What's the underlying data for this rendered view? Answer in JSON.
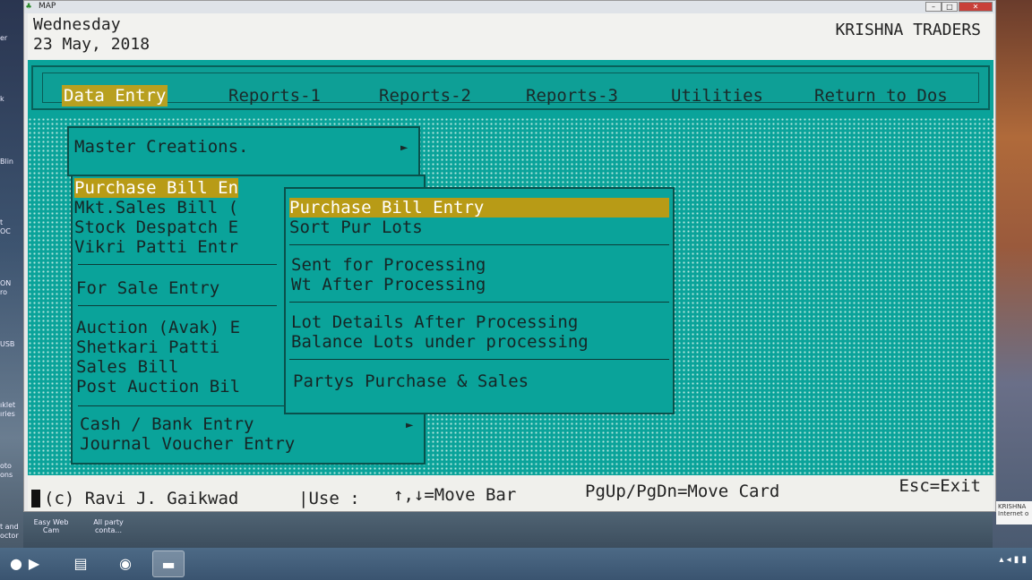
{
  "window": {
    "title": "MAP",
    "btn_min": "–",
    "btn_max": "□",
    "btn_close": "✕"
  },
  "header": {
    "day": "Wednesday",
    "date": "23 May, 2018",
    "company": "KRISHNA TRADERS"
  },
  "menubar": [
    {
      "label": "Data Entry",
      "active": true
    },
    {
      "label": "Reports-1"
    },
    {
      "label": "Reports-2"
    },
    {
      "label": "Reports-3"
    },
    {
      "label": "Utilities"
    },
    {
      "label": "Return to Dos"
    }
  ],
  "main_menu": {
    "master": "Master Creations.",
    "items_a": [
      "Purchase Bill En",
      "Mkt.Sales Bill (",
      "Stock Despatch E",
      "Vikri Patti Entr"
    ],
    "item_b": "For Sale Entry",
    "items_c": [
      "Auction (Avak) E",
      "Shetkari Patti",
      "Sales Bill",
      "Post Auction Bil"
    ],
    "items_d": [
      "Cash / Bank Entry",
      "Journal Voucher Entry"
    ],
    "arrow": "►"
  },
  "submenu": {
    "group1": [
      "Purchase Bill Entry",
      "Sort Pur Lots"
    ],
    "group2": [
      "Sent for Processing",
      "Wt After Processing"
    ],
    "group3": [
      "Lot Details After Processing",
      "Balance Lots under processing"
    ],
    "group4": [
      "Partys Purchase & Sales"
    ]
  },
  "status": {
    "copyright": "(c) Ravi J. Gaikwad",
    "use": "|Use :",
    "move_bar": "↑,↓=Move Bar",
    "move_card": "PgUp/PgDn=Move Card",
    "exit": "Esc=Exit"
  },
  "desktop": {
    "left_labels": [
      "er",
      "k",
      "Blin",
      "t",
      "OC",
      "ON",
      "ro",
      "USB",
      "ıklet",
      "ıries",
      "oto",
      "ons",
      "t and",
      "octor"
    ],
    "bottom_icons": [
      "Easy Web Cam",
      "All party conta..."
    ],
    "notification": "KRISHNA Internet o"
  }
}
